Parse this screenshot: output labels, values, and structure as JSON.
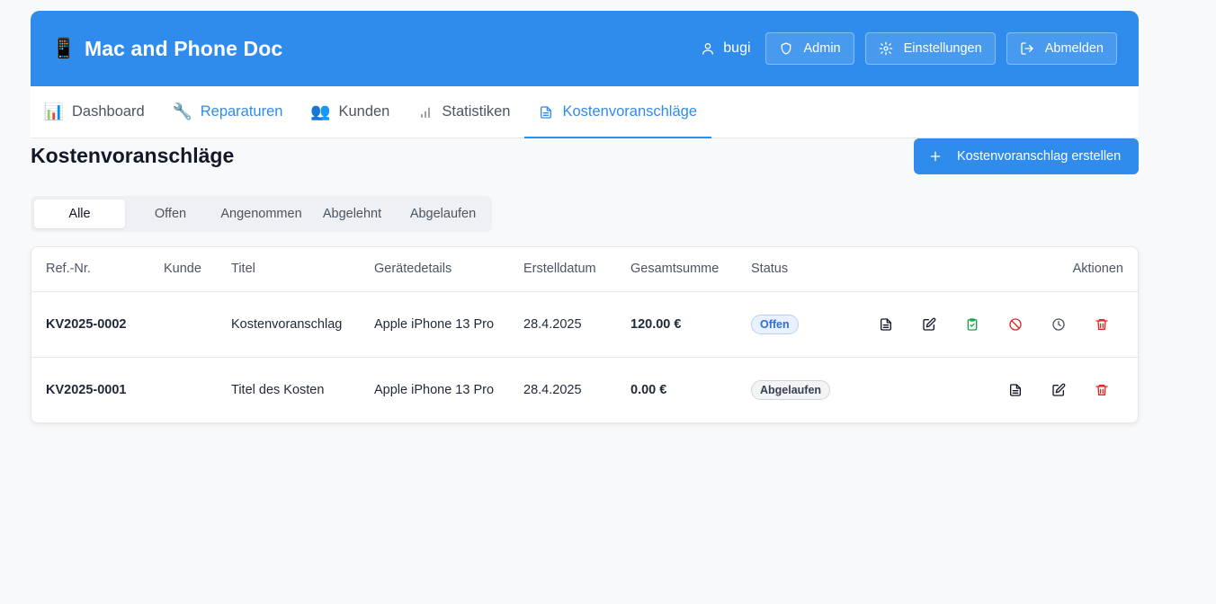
{
  "header": {
    "brand_icon": "📱",
    "title": "Mac and Phone Doc",
    "username": "bugi",
    "admin_label": "Admin",
    "settings_label": "Einstellungen",
    "logout_label": "Abmelden"
  },
  "nav": {
    "dashboard": {
      "icon": "📊",
      "label": "Dashboard"
    },
    "repairs": {
      "icon": "🔧",
      "label": "Reparaturen"
    },
    "customers": {
      "icon": "👥",
      "label": "Kunden"
    },
    "stats": {
      "label": "Statistiken"
    },
    "quotes": {
      "label": "Kostenvoranschläge"
    }
  },
  "page": {
    "title": "Kostenvoranschläge",
    "create_label": "Kostenvoranschlag erstellen"
  },
  "filters": [
    "Alle",
    "Offen",
    "Angenommen",
    "Abgelehnt",
    "Abgelaufen"
  ],
  "table": {
    "headers": [
      "Ref.-Nr.",
      "Kunde",
      "Titel",
      "Gerätedetails",
      "Erstelldatum",
      "Gesamtsumme",
      "Status",
      "Aktionen"
    ],
    "rows": [
      {
        "ref": "KV2025-0002",
        "customer": "",
        "title": "Kostenvoranschlag",
        "device": "Apple iPhone 13 Pro",
        "date": "28.4.2025",
        "total": "120.00 €",
        "status": "Offen"
      },
      {
        "ref": "KV2025-0001",
        "customer": "",
        "title": "Titel des Kosten",
        "device": "Apple iPhone 13 Pro",
        "date": "28.4.2025",
        "total": "0.00 €",
        "status": "Abgelaufen"
      }
    ]
  },
  "colors": {
    "primary": "#2f8cec",
    "accept": "#16a34a",
    "reject": "#dc2626",
    "delete": "#dc2626"
  }
}
